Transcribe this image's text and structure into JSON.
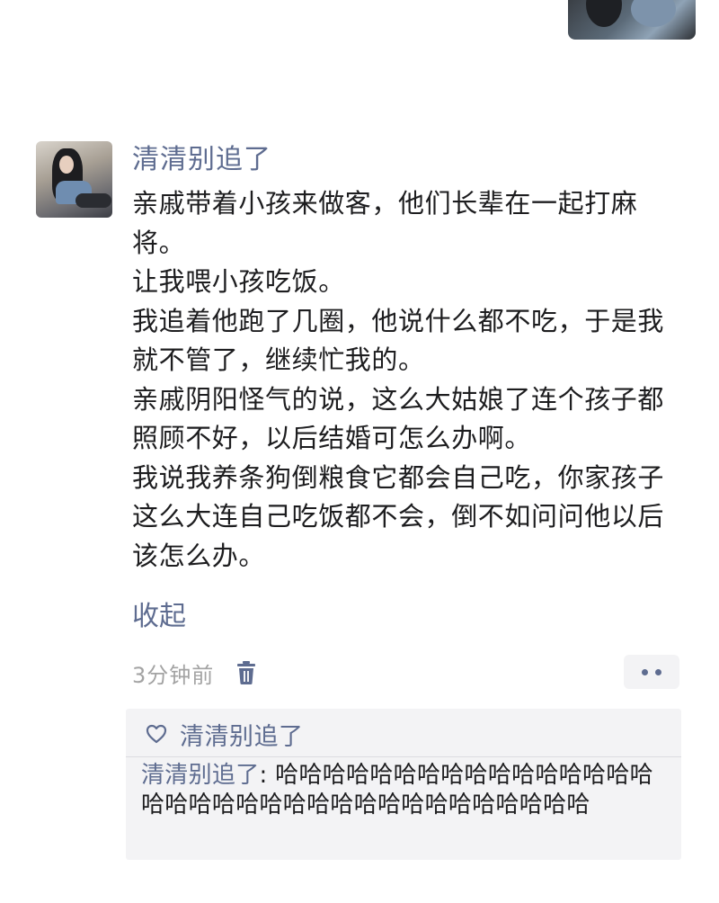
{
  "post": {
    "username": "清清别追了",
    "paragraphs": [
      "亲戚带着小孩来做客，他们长辈在一起打麻将。",
      "让我喂小孩吃饭。",
      "我追着他跑了几圈，他说什么都不吃，于是我就不管了，继续忙我的。",
      "亲戚阴阳怪气的说，这么大姑娘了连个孩子都照顾不好，以后结婚可怎么办啊。",
      "我说我养条狗倒粮食它都会自己吃，你家孩子这么大连自己吃饭都不会，倒不如问问他以后该怎么办。"
    ],
    "collapse_label": "收起",
    "timestamp": "3分钟前"
  },
  "likes": {
    "names": "清清别追了"
  },
  "comments": [
    {
      "author": "清清别追了",
      "separator": ": ",
      "text": "哈哈哈哈哈哈哈哈哈哈哈哈哈哈哈哈哈哈哈哈哈哈哈哈哈哈哈哈哈哈哈哈哈哈哈"
    }
  ],
  "icons": {
    "trash": "trash-icon",
    "more": "more-dots-icon",
    "heart": "heart-outline-icon"
  },
  "colors": {
    "link": "#5e6c90",
    "text": "#1d1d1f",
    "timestamp": "#a3a3a3",
    "panel_bg": "#f3f3f5"
  }
}
